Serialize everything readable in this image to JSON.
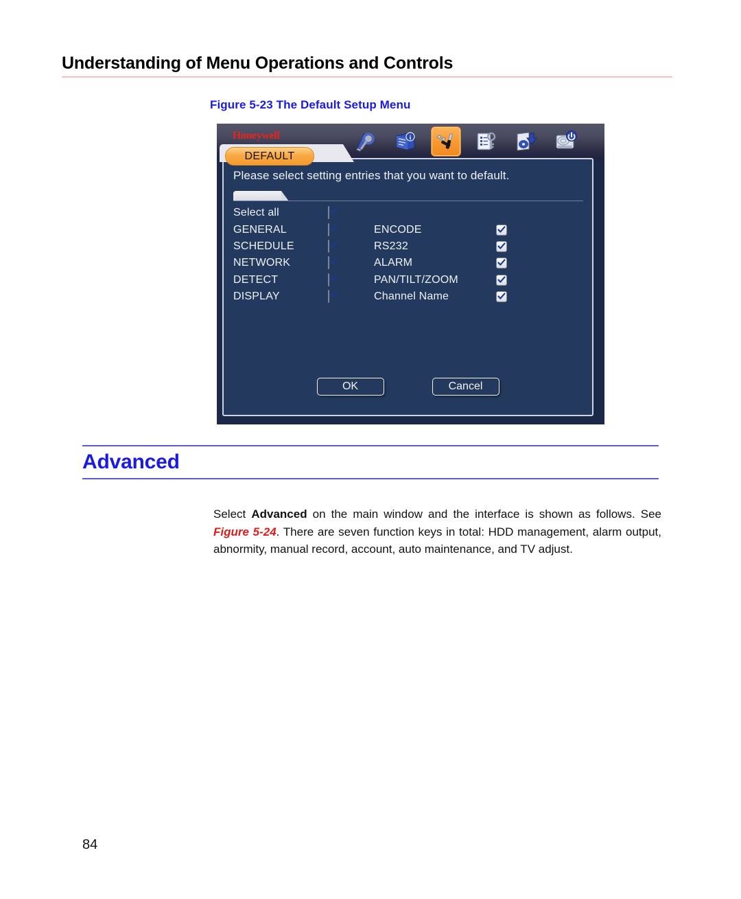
{
  "page": {
    "header_title": "Understanding of Menu Operations and Controls",
    "page_number": "84"
  },
  "figure": {
    "caption": "Figure 5-23 The Default Setup Menu",
    "colors": {
      "panel_background": "#233a5e",
      "window_background": "#1c2847",
      "accent_orange": "#f59a2c",
      "logo_red": "#e8231c",
      "checkmark_blue": "#1b3a8f"
    },
    "brand": "Honeywell",
    "active_tab": "DEFAULT",
    "toolbar_icons": [
      {
        "name": "search-icon",
        "active": false
      },
      {
        "name": "info-book-icon",
        "active": false
      },
      {
        "name": "settings-tools-icon",
        "active": true
      },
      {
        "name": "advanced-clipboard-key-icon",
        "active": false
      },
      {
        "name": "backup-disk-icon",
        "active": false
      },
      {
        "name": "shutdown-device-icon",
        "active": false
      }
    ],
    "instruction": "Please select setting entries that you want to default.",
    "select_all": {
      "label": "Select all",
      "checked": true
    },
    "entries": [
      {
        "left_label": "GENERAL",
        "left_checked": true,
        "right_label": "ENCODE",
        "right_checked": true
      },
      {
        "left_label": "SCHEDULE",
        "left_checked": true,
        "right_label": "RS232",
        "right_checked": true
      },
      {
        "left_label": "NETWORK",
        "left_checked": true,
        "right_label": "ALARM",
        "right_checked": true
      },
      {
        "left_label": "DETECT",
        "left_checked": true,
        "right_label": "PAN/TILT/ZOOM",
        "right_checked": true
      },
      {
        "left_label": "DISPLAY",
        "left_checked": true,
        "right_label": "Channel Name",
        "right_checked": true
      }
    ],
    "buttons": {
      "ok": "OK",
      "cancel": "Cancel"
    }
  },
  "section": {
    "heading": "Advanced"
  },
  "paragraph": {
    "part1": "Select ",
    "bold1": "Advanced",
    "part2": " on the main window and the interface is shown as follows. See ",
    "figref": "Figure 5-24",
    "part3": ". There are seven function keys in total: HDD management, alarm output, abnormity, manual record, account, auto maintenance, and TV adjust."
  }
}
